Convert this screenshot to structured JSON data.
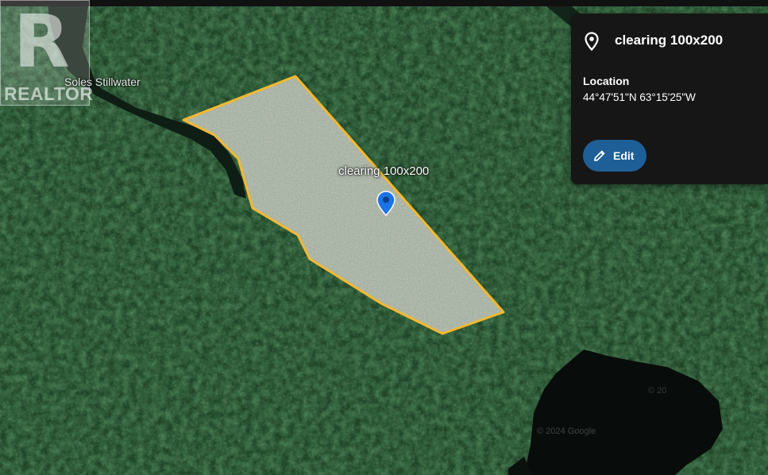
{
  "map": {
    "place_label": "Soles Stillwater",
    "polygon_label": "clearing 100x200",
    "watermark": "REALTOR",
    "copyright_text": "© 2024 Google",
    "copyright_text_2": "© 20"
  },
  "info_panel": {
    "title": "clearing 100x200",
    "location_label": "Location",
    "location_value": "44°47'51\"N 63°15'25\"W",
    "edit_label": "Edit"
  },
  "colors": {
    "polygon_outline": "#f5b82e",
    "polygon_fill": "#c9d3c3",
    "pin_blue": "#1a73e8",
    "edit_button": "#1f5f97",
    "panel_bg": "#161616"
  },
  "icons": {
    "panel_icon": "location-pin-outline-icon",
    "button_icon": "pencil-icon",
    "map_marker": "map-pin-icon"
  }
}
